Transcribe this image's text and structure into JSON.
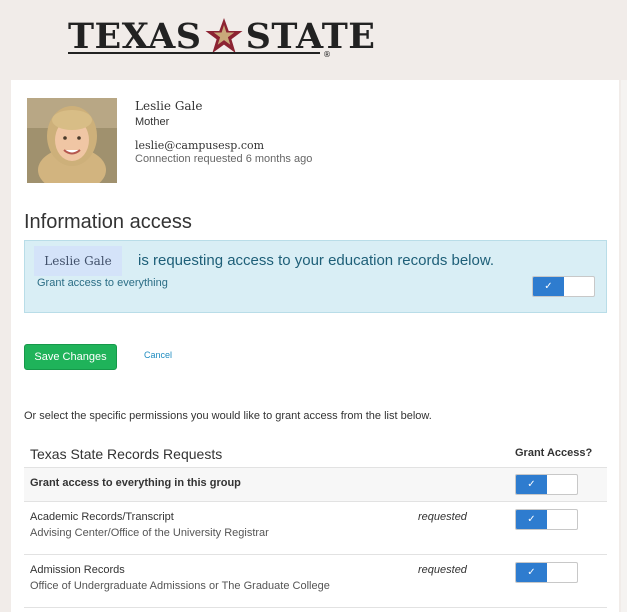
{
  "header": {
    "logo_left": "TEXAS",
    "logo_right": "STATE",
    "logo_reg": "®",
    "logo_icon": "star-icon",
    "colors": {
      "star": "#8c2332",
      "background": "#f1ece9"
    }
  },
  "profile": {
    "name": "Leslie Gale",
    "relationship": "Mother",
    "email": "leslie@campusesp.com",
    "status": "Connection requested 6 months ago"
  },
  "info_access": {
    "title": "Information access",
    "requester_name": "Leslie Gale",
    "request_text": "is requesting access to your education records below.",
    "grant_all_label": "Grant access to everything",
    "grant_all_on": true,
    "toggle_check": "✓"
  },
  "actions": {
    "save_label": "Save Changes",
    "cancel_label": "Cancel"
  },
  "instructions": "Or select the specific permissions you would like to grant access from the list below.",
  "records_table": {
    "title": "Texas State Records Requests",
    "grant_header": "Grant Access?",
    "group_row": {
      "label": "Grant access to everything in this group",
      "on": true
    },
    "rows": [
      {
        "title": "Academic Records/Transcript",
        "office": "Advising Center/Office of the University Registrar",
        "status": "requested",
        "on": true
      },
      {
        "title": "Admission Records",
        "office": "Office of Undergraduate Admissions or The Graduate College",
        "status": "requested",
        "on": true
      }
    ]
  },
  "colors": {
    "accent_blue": "#2e7ccf",
    "save_green": "#1fb35a",
    "info_box": "#d9eef5",
    "link": "#1f8cc0"
  }
}
